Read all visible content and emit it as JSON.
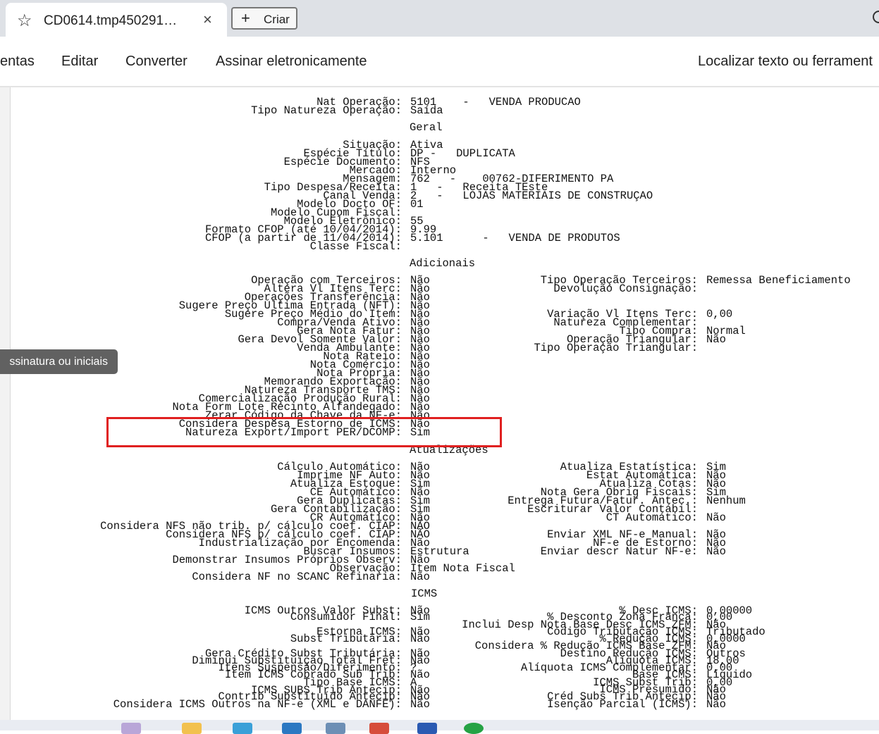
{
  "browser": {
    "tab_title": "CD0614.tmp450291…",
    "new_button_label": "Criar"
  },
  "toolbar": {
    "items": [
      "entas",
      "Editar",
      "Converter",
      "Assinar eletronicamente"
    ],
    "search_label": "Localizar texto ou ferrament"
  },
  "tooltip": "ssinatura ou iniciais",
  "document": {
    "top_fields": [
      {
        "label": "Nat Operação:",
        "value": "5101    -   VENDA PRODUCAO"
      },
      {
        "label": "Tipo Natureza Operação:",
        "value": "Saída"
      }
    ],
    "section_geral": "Geral",
    "geral_fields": [
      {
        "label": "Situação:",
        "value": "Ativa"
      },
      {
        "label": "Espécie Título:",
        "value": "DP -   DUPLICATA"
      },
      {
        "label": "Espécie Documento:",
        "value": "NFS"
      },
      {
        "label": "Mercado:",
        "value": "Interno"
      },
      {
        "label": "Mensagem:",
        "value": "762   -    00762-DIFERIMENTO PA"
      },
      {
        "label": "Tipo Despesa/Receita:",
        "value": "1   -   Receita TEste"
      },
      {
        "label": "Canal Venda:",
        "value": "2   -   LOJAS MATERIAIS DE CONSTRUÇAO"
      },
      {
        "label": "Modelo Docto OF:",
        "value": "01"
      },
      {
        "label": "Modelo Cupom Fiscal:",
        "value": ""
      },
      {
        "label": "Modelo Eletrônico:",
        "value": "55"
      },
      {
        "label": "Formato CFOP (até 10/04/2014):",
        "value": "9.99"
      },
      {
        "label": "CFOP (a partir de 11/04/2014):",
        "value": "5.101      -   VENDA DE PRODUTOS"
      },
      {
        "label": "Classe Fiscal:",
        "value": ""
      }
    ],
    "section_adicionais": "Adicionais",
    "adicionais_left": [
      {
        "label": "Operação com Terceiros:",
        "value": "Não"
      },
      {
        "label": "Altera Vl Itens Terc:",
        "value": "Não"
      },
      {
        "label": "Operações Transferência:",
        "value": "Não"
      },
      {
        "label": "Sugere Preço Última Entrada (NFT):",
        "value": "Não"
      },
      {
        "label": "Sugere Preço Médio do Item:",
        "value": "Não"
      },
      {
        "label": "Compra/Venda Ativo:",
        "value": "Não"
      },
      {
        "label": "Gera Nota Fatur:",
        "value": "Não"
      },
      {
        "label": "Gera Devol Somente Valor:",
        "value": "Não"
      },
      {
        "label": "Venda Ambulante:",
        "value": "Não"
      },
      {
        "label": "Nota Rateio:",
        "value": "Não"
      },
      {
        "label": "Nota Comércio:",
        "value": "Não"
      },
      {
        "label": "Nota Própria:",
        "value": "Não"
      },
      {
        "label": "Memorando Exportação:",
        "value": "Não"
      },
      {
        "label": "Natureza Transporte TMS:",
        "value": "Não"
      },
      {
        "label": "Comercialização Produção Rural:",
        "value": "Não"
      },
      {
        "label": "Nota Form Lote Recinto Alfandegado:",
        "value": "Não"
      },
      {
        "label": "Zerar Código da Chave da NF-e:",
        "value": "Não"
      },
      {
        "label": "Considera Despesa Estorno de ICMS:",
        "value": "Não"
      },
      {
        "label": "Natureza Export/Import PER/DCOMP:",
        "value": "Sim"
      }
    ],
    "adicionais_right": [
      {
        "label": "Tipo Operação Terceiros:",
        "value": "Remessa Beneficiamento",
        "row": 0
      },
      {
        "label": "Devolução Consignação:",
        "value": "",
        "row": 1
      },
      {
        "label": "Variação Vl Itens Terc:",
        "value": "0,00",
        "row": 4
      },
      {
        "label": "Natureza Complementar:",
        "value": "",
        "row": 5
      },
      {
        "label": "Tipo Compra:",
        "value": "Normal",
        "row": 6
      },
      {
        "label": "Operação Triangular:",
        "value": "Não",
        "row": 7
      },
      {
        "label": "Tipo Operação Triangular:",
        "value": "",
        "row": 8
      }
    ],
    "section_atualizacoes": "Atualizações",
    "atual_left": [
      {
        "label": "Cálculo Automático:",
        "value": "Não"
      },
      {
        "label": "Imprime NF Auto:",
        "value": "Não"
      },
      {
        "label": "Atualiza Estoque:",
        "value": "Sim"
      },
      {
        "label": "CE Automático:",
        "value": "Não"
      },
      {
        "label": "Gera Duplicatas:",
        "value": "Sim"
      },
      {
        "label": "Gera Contabilização:",
        "value": "Sim"
      },
      {
        "label": "CR Automático:",
        "value": "Não"
      },
      {
        "label": "Considera NFS não trib. p/ cálculo coef. CIAP:",
        "value": "NÃO"
      },
      {
        "label": "Considera NFS p/ cálculo coef. CIAP:",
        "value": "NÃO"
      },
      {
        "label": "Industrialização por Encomenda:",
        "value": "Não"
      },
      {
        "label": "Buscar Insumos:",
        "value": "Estrutura"
      },
      {
        "label": "Demonstrar Insumos Próprios Observ:",
        "value": "Não"
      },
      {
        "label": "Observação:",
        "value": "Item Nota Fiscal"
      },
      {
        "label": "Considera NF no SCANC Refinaria:",
        "value": "Não"
      }
    ],
    "atual_right": [
      {
        "label": "Atualiza Estatística:",
        "value": "Sim",
        "row": 0
      },
      {
        "label": "Estat Automática:",
        "value": "Não",
        "row": 1
      },
      {
        "label": "Atualiza Cotas:",
        "value": "Não",
        "row": 2
      },
      {
        "label": "Nota Gera Obrig Fiscais:",
        "value": "Sim",
        "row": 3
      },
      {
        "label": "Entrega Futura/Fatur. Antec.:",
        "value": "Nenhum",
        "row": 4
      },
      {
        "label": "Escriturar Valor Contábil:",
        "value": "",
        "row": 5
      },
      {
        "label": "CT Automático:",
        "value": "Não",
        "row": 6
      },
      {
        "label": "Enviar XML NF-e Manual:",
        "value": "Não",
        "row": 8
      },
      {
        "label": "NF-e de Estorno:",
        "value": "Não",
        "row": 9
      },
      {
        "label": "Enviar descr Natur NF-e:",
        "value": "Não",
        "row": 10
      }
    ],
    "section_icms": "ICMS",
    "icms_left": [
      {
        "label": "ICMS Outros Valor Subst:",
        "value": "Não"
      },
      {
        "label": "Consumidor Final:",
        "value": "Sim"
      },
      {
        "label": "Estorna ICMS:",
        "value": "Não"
      },
      {
        "label": "Subst Tributária:",
        "value": "Não"
      },
      {
        "label": "Gera Crédito Subst Tributária:",
        "value": "Não"
      },
      {
        "label": "Diminui Substituição Total Fret:",
        "value": "Não"
      },
      {
        "label": "Itens Suspensão/Diferimento:",
        "value": "?"
      },
      {
        "label": "Item ICMS Cobrado Sub Trib:",
        "value": "Não"
      },
      {
        "label": "Tipo Base ICMS:",
        "value": "A"
      },
      {
        "label": "ICMS SUBS Trib Antecip:",
        "value": "Não"
      },
      {
        "label": "Contrib Substituído Antecip:",
        "value": "Não"
      },
      {
        "label": "Considera ICMS Outros na NF-e (XML e DANFE):",
        "value": "Não"
      }
    ],
    "icms_right": [
      {
        "label": "% Desc ICMS:",
        "value": "0,00000"
      },
      {
        "label": "% Desconto Zona Franca:",
        "value": "0,00"
      },
      {
        "label": "Inclui Desp Nota Base Desc ICMS ZFM:",
        "value": "Não"
      },
      {
        "label": "Código Tributação ICMS:",
        "value": "Tributado"
      },
      {
        "label": "% Redução ICMS:",
        "value": "0,0000"
      },
      {
        "label": "Considera % Redução ICMS Base ZFM:",
        "value": "Não"
      },
      {
        "label": "Destino Redução ICMS:",
        "value": "Outros"
      },
      {
        "label": "Alíquota ICMS:",
        "value": "18,00"
      },
      {
        "label": "Alíquota ICMS Complementar:",
        "value": "0,00"
      },
      {
        "label": "Base ICMS:",
        "value": "Líquido"
      },
      {
        "label": "ICMS Subst Trib:",
        "value": "0,00"
      },
      {
        "label": "ICMS Presumido:",
        "value": "Não"
      },
      {
        "label": "Créd Subs Trib Antecip:",
        "value": "Não"
      },
      {
        "label": "Isenção Parcial (ICMS):",
        "value": "Não"
      }
    ]
  }
}
